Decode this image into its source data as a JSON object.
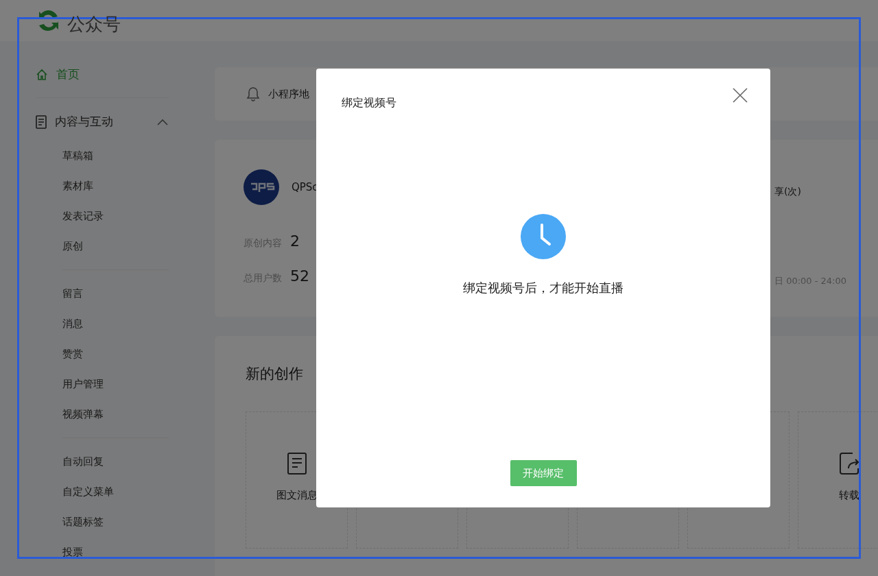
{
  "header": {
    "title": "公众号"
  },
  "sidebar": {
    "home": {
      "label": "首页",
      "selected": true
    },
    "group": {
      "label": "内容与互动",
      "expanded": true,
      "sections": [
        {
          "items": [
            {
              "label": "草稿箱",
              "selected": false
            },
            {
              "label": "素材库",
              "selected": false
            },
            {
              "label": "发表记录",
              "selected": false
            },
            {
              "label": "原创",
              "selected": false
            }
          ]
        },
        {
          "items": [
            {
              "label": "留言",
              "selected": false
            },
            {
              "label": "消息",
              "selected": false
            },
            {
              "label": "赞赏",
              "selected": false
            },
            {
              "label": "用户管理",
              "selected": false
            },
            {
              "label": "视频弹幕",
              "selected": false
            }
          ]
        },
        {
          "items": [
            {
              "label": "自动回复",
              "selected": false
            },
            {
              "label": "自定义菜单",
              "selected": false
            },
            {
              "label": "话题标签",
              "selected": false
            },
            {
              "label": "投票",
              "selected": false
            }
          ]
        }
      ]
    }
  },
  "notice": {
    "text": "小程序地"
  },
  "account": {
    "name": "QPSc",
    "stats": [
      {
        "label": "原创内容",
        "value": "2"
      },
      {
        "label": "总用户数",
        "value": "52"
      }
    ],
    "metric_label": "享(次)",
    "metric_period": "日 00:00 - 24:00"
  },
  "creation": {
    "title": "新的创作",
    "cards": [
      {
        "kind": "article",
        "label": "图文消息"
      },
      {
        "kind": "blank"
      },
      {
        "kind": "blank"
      },
      {
        "kind": "blank"
      },
      {
        "kind": "blank"
      },
      {
        "kind": "repost",
        "label": "转载"
      }
    ]
  },
  "dialog": {
    "title": "绑定视频号",
    "message": "绑定视频号后，才能开始直播",
    "button": "开始绑定"
  }
}
